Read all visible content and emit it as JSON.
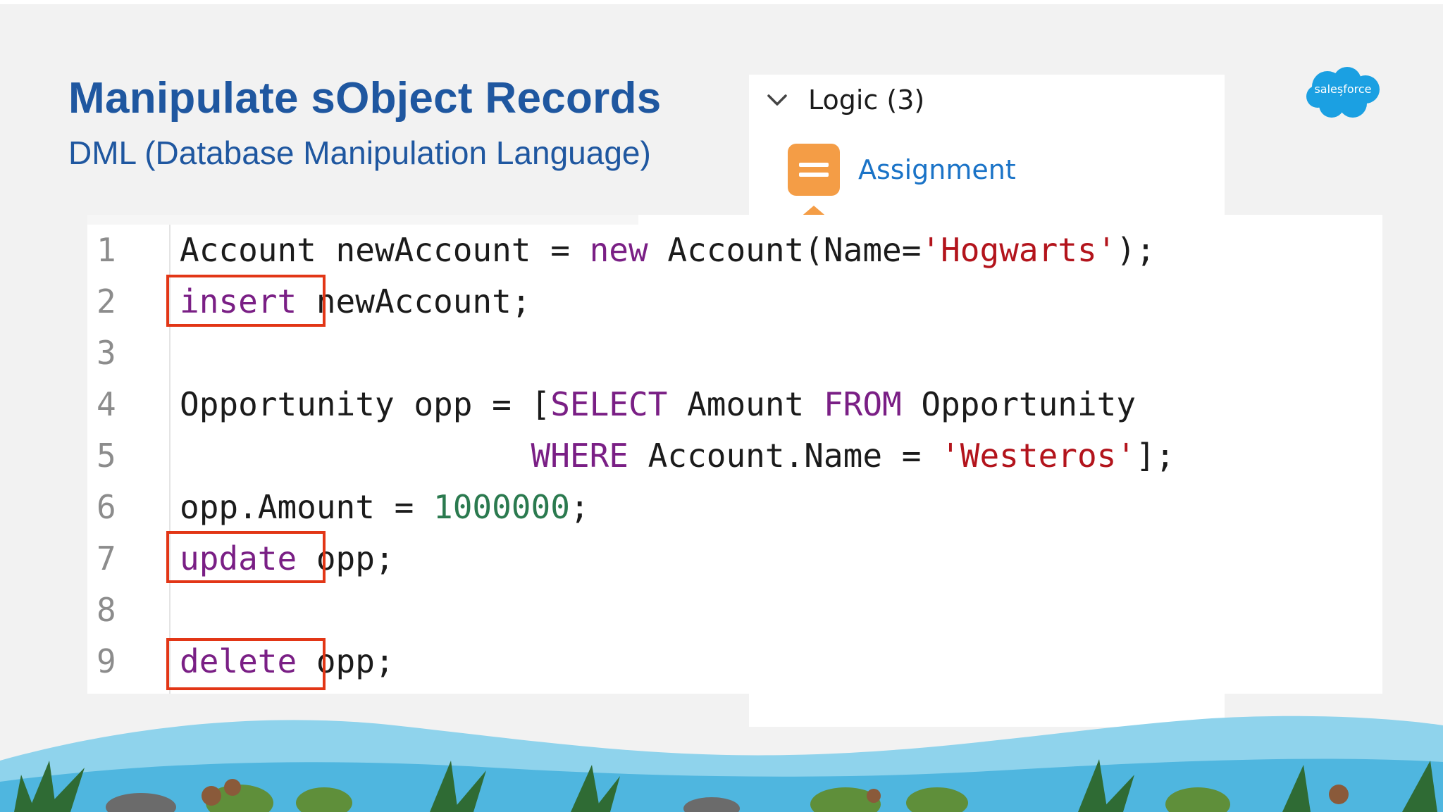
{
  "slide": {
    "title": "Manipulate sObject Records",
    "subtitle": "DML (Database Manipulation Language)"
  },
  "palette": {
    "header": "Logic (3)",
    "item_label": "Assignment"
  },
  "logo": {
    "text": "salesforce"
  },
  "code": {
    "lines": [
      {
        "num": "1",
        "parts": [
          {
            "t": "Account newAccount = ",
            "c": ""
          },
          {
            "t": "new",
            "c": "kw"
          },
          {
            "t": " Account(Name=",
            "c": ""
          },
          {
            "t": "'Hogwarts'",
            "c": "str"
          },
          {
            "t": ");",
            "c": ""
          }
        ]
      },
      {
        "num": "2",
        "parts": [
          {
            "t": "insert",
            "c": "kw"
          },
          {
            "t": " newAccount;",
            "c": ""
          }
        ]
      },
      {
        "num": "3",
        "parts": []
      },
      {
        "num": "4",
        "parts": [
          {
            "t": "Opportunity opp = [",
            "c": ""
          },
          {
            "t": "SELECT",
            "c": "kw"
          },
          {
            "t": " Amount ",
            "c": ""
          },
          {
            "t": "FROM",
            "c": "kw"
          },
          {
            "t": " Opportunity",
            "c": ""
          }
        ]
      },
      {
        "num": "5",
        "parts": [
          {
            "t": "                  ",
            "c": ""
          },
          {
            "t": "WHERE",
            "c": "kw"
          },
          {
            "t": " Account.Name = ",
            "c": ""
          },
          {
            "t": "'Westeros'",
            "c": "str"
          },
          {
            "t": "];",
            "c": ""
          }
        ]
      },
      {
        "num": "6",
        "parts": [
          {
            "t": "opp.Amount = ",
            "c": ""
          },
          {
            "t": "1000000",
            "c": "num"
          },
          {
            "t": ";",
            "c": ""
          }
        ]
      },
      {
        "num": "7",
        "parts": [
          {
            "t": "update",
            "c": "kw"
          },
          {
            "t": " opp;",
            "c": ""
          }
        ]
      },
      {
        "num": "8",
        "parts": []
      },
      {
        "num": "9",
        "parts": [
          {
            "t": "delete",
            "c": "kw"
          },
          {
            "t": " opp;",
            "c": ""
          }
        ]
      }
    ],
    "highlighted_keywords": [
      "insert",
      "update",
      "delete"
    ]
  },
  "colors": {
    "title": "#1f57a0",
    "keyword": "#7a1f85",
    "string": "#b3141c",
    "number": "#2b7a4f",
    "highlight_box": "#e23616",
    "assignment_icon": "#f49d46",
    "logo": "#1ba0e2"
  },
  "icons": [
    "chevron-down-icon",
    "assignment-icon",
    "salesforce-logo"
  ]
}
